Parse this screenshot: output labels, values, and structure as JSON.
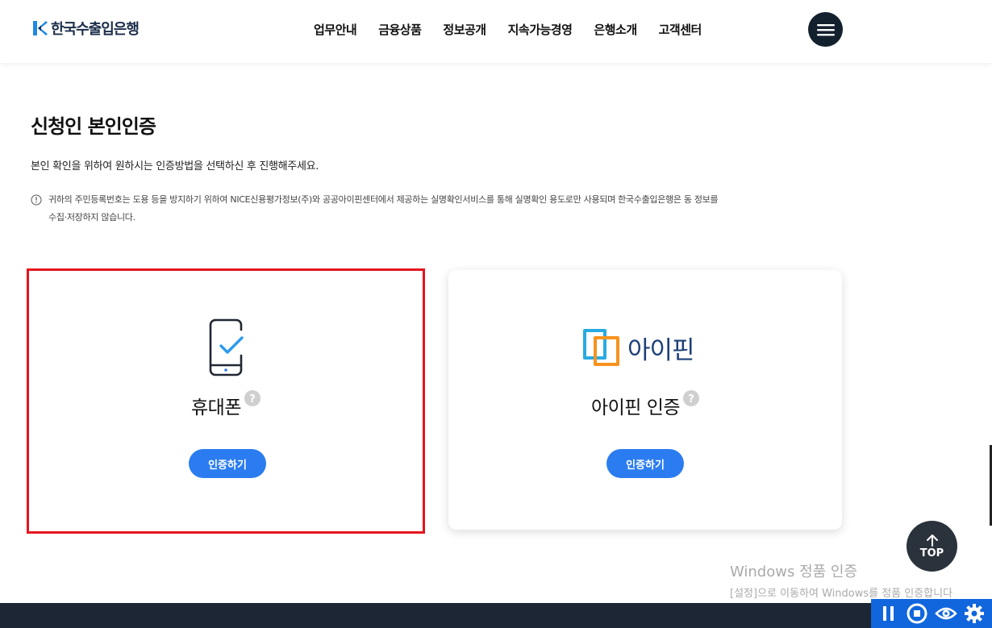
{
  "header": {
    "logo_text": "한국수출입은행",
    "nav": [
      "업무안내",
      "금융상품",
      "정보공개",
      "지속가능경영",
      "은행소개",
      "고객센터"
    ]
  },
  "page": {
    "title": "신청인 본인인증",
    "description": "본인 확인을 위하여 원하시는 인증방법을 선택하신 후 진행해주세요.",
    "notice": "귀하의 주민등록번호는 도용 등을 방지하기 위하여 NICE신용평가정보(주)와 공공아이핀센터에서 제공하는 실명확인서비스를 통해 실명확인 용도로만 사용되며 한국수출입은행은 동 정보를\n수집·저장하지 않습니다."
  },
  "methods": {
    "phone": {
      "label": "휴대폰",
      "button": "인증하기",
      "icon": "mobile-check-icon"
    },
    "ipin": {
      "label": "아이핀 인증",
      "logo_text": "아이핀",
      "button": "인증하기",
      "icon": "ipin-logo"
    }
  },
  "top_button": {
    "label": "TOP"
  },
  "watermark": {
    "title": "Windows 정품 인증",
    "subtitle": "[설정]으로 이동하여 Windows를 정품 인증합니다"
  },
  "colors": {
    "accent": "#2b7cf0",
    "highlight": "#e4151f",
    "menu_dark": "#13202e",
    "footer": "#1d2634",
    "ipin_orange": "#f7931e",
    "ipin_blue": "#29abe2"
  }
}
